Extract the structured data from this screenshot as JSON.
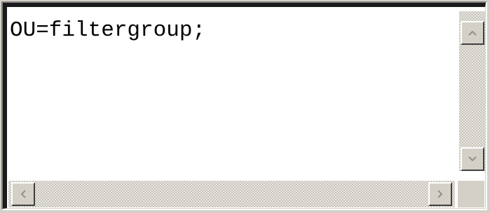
{
  "editor": {
    "text": "OU=filtergroup;"
  },
  "scrollbars": {
    "vertical": {
      "up_icon": "chevron-up-icon",
      "down_icon": "chevron-down-icon"
    },
    "horizontal": {
      "left_icon": "chevron-left-icon",
      "right_icon": "chevron-right-icon"
    }
  },
  "colors": {
    "frame": "#d4d0c8",
    "text": "#000000",
    "background": "#ffffff",
    "border_dark": "#1a1a1a"
  }
}
